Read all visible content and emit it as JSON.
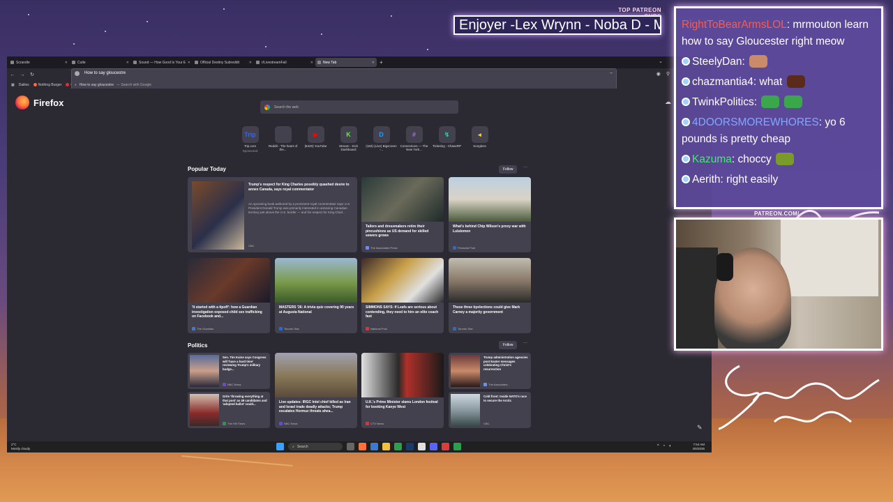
{
  "overlay": {
    "patreon_header": "TOP PATREON SUBS",
    "patreon_ticker": "Enjoyer -Lex Wrynn -  Noba D - M",
    "patreon_link": "PATREON.COM/"
  },
  "browser": {
    "tabs": [
      {
        "label": "Scrandle",
        "active": false
      },
      {
        "label": "Cutle",
        "active": false
      },
      {
        "label": "Sound — How Good Is Your Ea",
        "active": false
      },
      {
        "label": "Official Destiny Subreddit",
        "active": false
      },
      {
        "label": "r/LivestreamFail",
        "active": false
      },
      {
        "label": "New Tab",
        "active": true
      }
    ],
    "new_tab": "+",
    "url_value": "How to say gloucestre",
    "suggestion": "How to say gloucestre",
    "suggestion_suffix": "— Search with Google",
    "bookmarks": [
      "Dailies",
      "Nothing Burger",
      "Cl"
    ],
    "brand": "Firefox",
    "search_placeholder": "Search the web"
  },
  "shortcuts": [
    {
      "label": "Trip.com",
      "sub": "Sponsored",
      "icon": "trip-icon",
      "color": "#3264ff",
      "glyph": "Trip"
    },
    {
      "label": "Reddit - The heart of the...",
      "sub": "",
      "icon": "reddit-icon",
      "color": "#ff4500",
      "glyph": ""
    },
    {
      "label": "(8420) YouTube",
      "sub": "",
      "icon": "youtube-icon",
      "color": "#ff0000",
      "glyph": "▶"
    },
    {
      "label": "Stream - Kick Dashboard",
      "sub": "",
      "icon": "kick-icon",
      "color": "#53fc18",
      "glyph": "K"
    },
    {
      "label": "(183) (Live) Bigscreen -...",
      "sub": "",
      "icon": "bigscreen-icon",
      "color": "#2a9df4",
      "glyph": "D"
    },
    {
      "label": "Connections — The New York...",
      "sub": "",
      "icon": "connections-icon",
      "color": "#b06fe0",
      "glyph": "#"
    },
    {
      "label": "Ticketing - ChaseRP",
      "sub": "",
      "icon": "chaserp-icon",
      "color": "#1fd4a8",
      "glyph": "↯"
    },
    {
      "label": "Songless",
      "sub": "",
      "icon": "songless-icon",
      "color": "#f5d320",
      "glyph": "◂"
    }
  ],
  "popular": {
    "heading": "Popular Today",
    "follow": "Follow",
    "lead": {
      "title": "Trump's respect for King Charles possibly quashed desire to annex Canada, says royal commentator",
      "desc": "An upcoming book authored by a prominent royal commentator says U.S. President Donald Trump was primarily interested in annexing Canadian territory just above the U.S. border — and his respect for King Charl...",
      "source": "CBC"
    },
    "cards": [
      {
        "title": "Tailors and dressmakers retire their pincushions as US demand for skilled sewers grows",
        "source": "The Associated Press"
      },
      {
        "title": "What's behind Chip Wilson's proxy war with Lululemon",
        "source": "Financial Post"
      },
      {
        "title": "'It started with a tipoff': how a Guardian investigation exposed child sex trafficking on Facebook and...",
        "source": "The Guardian"
      },
      {
        "title": "MASTERS '26: A trivia quiz covering 90 years at Augusta National",
        "source": "Toronto Star"
      },
      {
        "title": "SIMMONS SAYS: If Leafs are serious about contending, they need to hire an elite coach fast",
        "source": "National Post"
      },
      {
        "title": "These three byelections could give Mark Carney a majority government",
        "source": "Toronto Star"
      }
    ]
  },
  "politics": {
    "heading": "Politics",
    "follow": "Follow",
    "cards": [
      {
        "title": "Sen. Tim Kaine says Congress will 'have a hard time' reviewing Trump's military budge...",
        "source": "NBC News"
      },
      {
        "title": "Live updates: IRGC Intel chief killed as Iran and Israel trade deadly attacks; Trump escalates Hormuz threats ahea...",
        "source": "NBC News"
      },
      {
        "title": "U.K.'s Prime Minister slams London festival for booking Kanye West",
        "source": "CTV News"
      },
      {
        "title": "Trump administration agencies post Easter messages celebrating Christ's resurrection",
        "source": "The Associated..."
      },
      {
        "title": "Grits 'throwing everything at that post' as 48 candidates and 'adopted ballot' could...",
        "source": "The Hill Times"
      },
      {
        "title": "Cold front: Inside NATO's race to secure the Arctic",
        "source": "CBC"
      }
    ]
  },
  "taskbar": {
    "temp": "2°C",
    "condition": "Mostly cloudy",
    "search": "Search",
    "time": "7:54 AM",
    "date": "4/6/2026"
  },
  "chat": [
    {
      "user": "RightToBearArmsLOL",
      "color": "#ff5a4a",
      "text": ": mrmouton learn how to say Gloucester right meow",
      "emotes": []
    },
    {
      "user": "SteelyDan",
      "color": "#ffffff",
      "text": ":",
      "emotes": [
        "#c98b6a"
      ]
    },
    {
      "user": "chazmantia4",
      "color": "#ffffff",
      "text": ": what",
      "emotes": [
        "#5a2a1a"
      ]
    },
    {
      "user": "TwinkPolitics",
      "color": "#ffffff",
      "text": ":",
      "emotes": [
        "#3aa84a",
        "#3aa84a"
      ]
    },
    {
      "user": "4DOORSMOREWHORES",
      "color": "#7fa8ff",
      "text": ": yo 6 pounds is pretty cheap",
      "emotes": []
    },
    {
      "user": "Kazuma",
      "color": "#4be37a",
      "text": ": choccy",
      "emotes": [
        "#7a9a2a"
      ]
    },
    {
      "user": "Aerith",
      "color": "#ffffff",
      "text": ": right easily",
      "emotes": []
    }
  ]
}
